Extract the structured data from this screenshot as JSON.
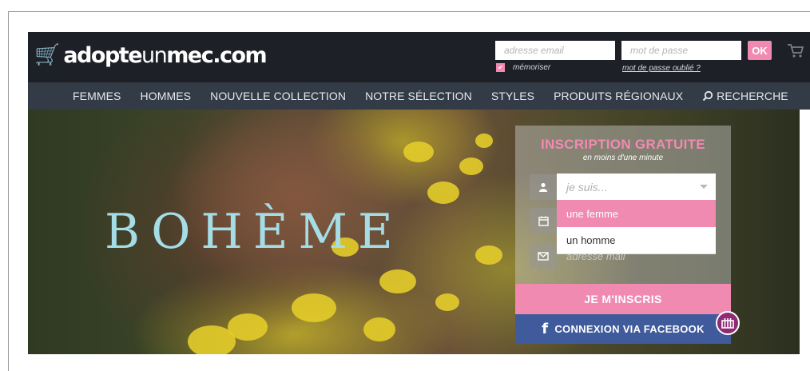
{
  "header": {
    "logo": {
      "part1": "adopte",
      "part2": "un",
      "part3": "mec",
      "part4": ".com"
    },
    "login": {
      "email_placeholder": "adresse email",
      "password_placeholder": "mot de passe",
      "ok_label": "OK",
      "remember_label": "mémoriser",
      "forgot_label": "mot de passe oublié ?"
    },
    "cart_icon": "cart-icon"
  },
  "nav": {
    "items": [
      {
        "label": "FEMMES"
      },
      {
        "label": "HOMMES"
      },
      {
        "label": "NOUVELLE COLLECTION"
      },
      {
        "label": "NOTRE SÉLECTION"
      },
      {
        "label": "STYLES"
      },
      {
        "label": "PRODUITS RÉGIONAUX"
      },
      {
        "label": "RECHERCHE",
        "icon": "search-icon"
      }
    ]
  },
  "hero": {
    "headline": "BOHÈME"
  },
  "signup": {
    "title": "INSCRIPTION GRATUITE",
    "subtitle": "en moins d'une minute",
    "gender_placeholder": "je suis...",
    "gender_options": [
      "une femme",
      "un homme"
    ],
    "selected_option": "une femme",
    "email_placeholder": "adresse mail",
    "submit_label": "JE M'INSCRIS",
    "facebook_label": "CONNEXION VIA FACEBOOK"
  },
  "colors": {
    "header_bg": "#1d2027",
    "nav_bg": "#323b46",
    "accent_pink": "#f08ab0",
    "facebook_blue": "#3f5b9b",
    "headline_cyan": "#a4dde6"
  }
}
